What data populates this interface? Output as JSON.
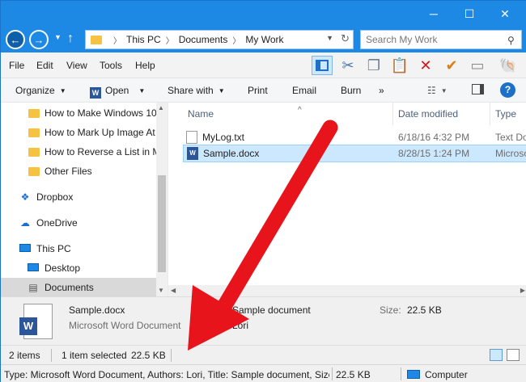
{
  "address": {
    "crumbs": [
      "This PC",
      "Documents",
      "My Work"
    ]
  },
  "search": {
    "placeholder": "Search My Work"
  },
  "menu": [
    "File",
    "Edit",
    "View",
    "Tools",
    "Help"
  ],
  "toolbar": {
    "organize": "Organize",
    "open": "Open",
    "share_with": "Share with",
    "print": "Print",
    "email": "Email",
    "burn": "Burn",
    "more": "»"
  },
  "nav": {
    "items": [
      {
        "label": "How to Make Windows 10",
        "type": "folder"
      },
      {
        "label": "How to Mark Up Image At",
        "type": "folder"
      },
      {
        "label": "How to Reverse a List in M",
        "type": "folder"
      },
      {
        "label": "Other Files",
        "type": "folder"
      },
      {
        "label": "Dropbox",
        "type": "dropbox"
      },
      {
        "label": "OneDrive",
        "type": "onedrive"
      },
      {
        "label": "This PC",
        "type": "pc"
      },
      {
        "label": "Desktop",
        "type": "desktop"
      },
      {
        "label": "Documents",
        "type": "documents"
      }
    ]
  },
  "columns": {
    "name": "Name",
    "date": "Date modified",
    "type": "Type"
  },
  "files": [
    {
      "name": "MyLog.txt",
      "date": "6/18/16 4:32 PM",
      "type": "Text Do"
    },
    {
      "name": "Sample.docx",
      "date": "8/28/15 1:24 PM",
      "type": "Microso"
    }
  ],
  "details": {
    "filename": "Sample.docx",
    "filetype": "Microsoft Word Document",
    "title_label": "Ti",
    "title_value": "Sample document",
    "authors_label": "A",
    "authors_value": "Lori",
    "size_label": "Size:",
    "size_value": "22.5 KB"
  },
  "status": {
    "items": "2 items",
    "selected": "1 item selected",
    "size": "22.5 KB"
  },
  "bottom": {
    "info": "Type: Microsoft Word Document, Authors: Lori, Title: Sample document, Size",
    "size": "22.5 KB",
    "location": "Computer"
  },
  "colors": {
    "titlebar": "#1e88e5",
    "selection": "#cce8ff",
    "arrow": "#e8141b"
  }
}
